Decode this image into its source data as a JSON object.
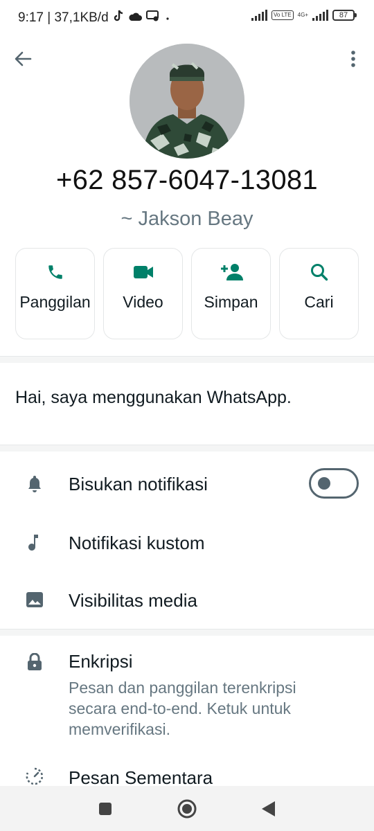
{
  "status_bar": {
    "time_speed": "9:17 | 37,1KB/d",
    "volte_label": "Vo LTE",
    "network_label": "4G+",
    "battery": "87"
  },
  "profile": {
    "phone": "+62 857-6047-13081",
    "pushname": "~ Jakson Beay"
  },
  "actions": [
    {
      "label": "Panggilan",
      "icon": "phone-icon"
    },
    {
      "label": "Video",
      "icon": "video-camera-icon"
    },
    {
      "label": "Simpan",
      "icon": "add-person-icon"
    },
    {
      "label": "Cari",
      "icon": "search-icon"
    }
  ],
  "about": "Hai, saya menggunakan WhatsApp.",
  "settings": {
    "mute": {
      "label": "Bisukan notifikasi",
      "enabled": false
    },
    "custom": {
      "label": "Notifikasi kustom"
    },
    "media": {
      "label": "Visibilitas media"
    }
  },
  "encryption": {
    "label": "Enkripsi",
    "description": "Pesan dan panggilan terenkripsi secara end-to-end. Ketuk untuk memverifikasi."
  },
  "disappearing": {
    "label": "Pesan Sementara"
  },
  "colors": {
    "accent": "#008069",
    "icon_gray": "#54656f",
    "secondary_text": "#667781"
  }
}
